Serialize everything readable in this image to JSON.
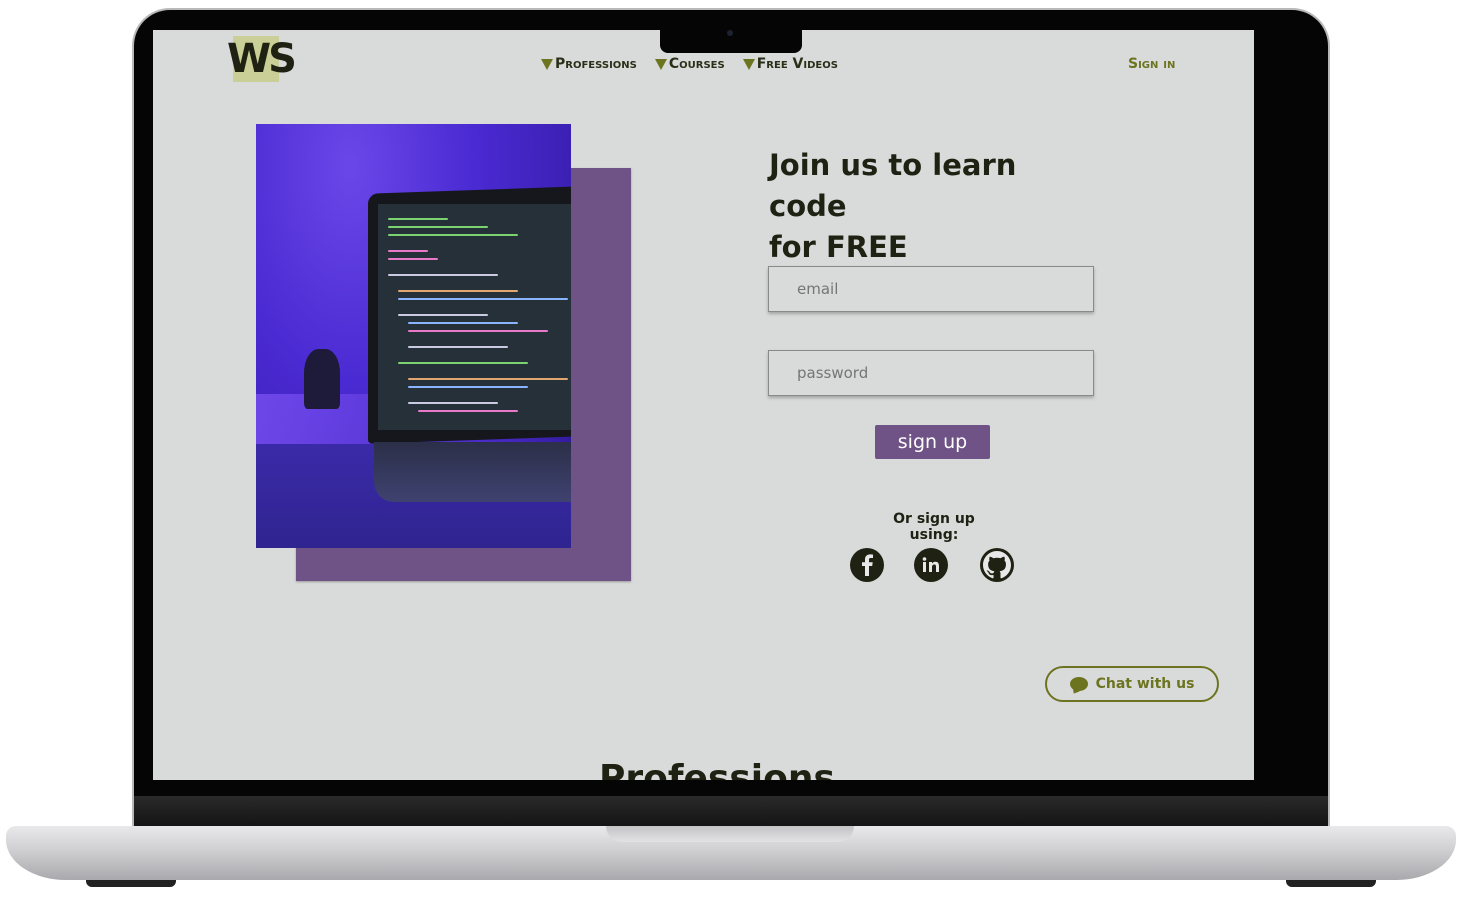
{
  "header": {
    "logo": "WS",
    "nav": [
      "Professions",
      "Courses",
      "Free Videos"
    ],
    "sign_in": "Sign in"
  },
  "hero": {
    "heading_line1": "Join us to learn code",
    "heading_line2": "for FREE"
  },
  "form": {
    "email_placeholder": "email",
    "password_placeholder": "password",
    "signup_label": "sign up",
    "or_text": "Or sign up using:"
  },
  "social": [
    "facebook-icon",
    "linkedin-icon",
    "github-icon"
  ],
  "chat": {
    "label": "Chat with us"
  },
  "next_section": {
    "title": "Professions"
  },
  "colors": {
    "accent": "#6d7420",
    "purple": "#6f5286",
    "background": "#d9dbdb",
    "text": "#1f2212"
  }
}
